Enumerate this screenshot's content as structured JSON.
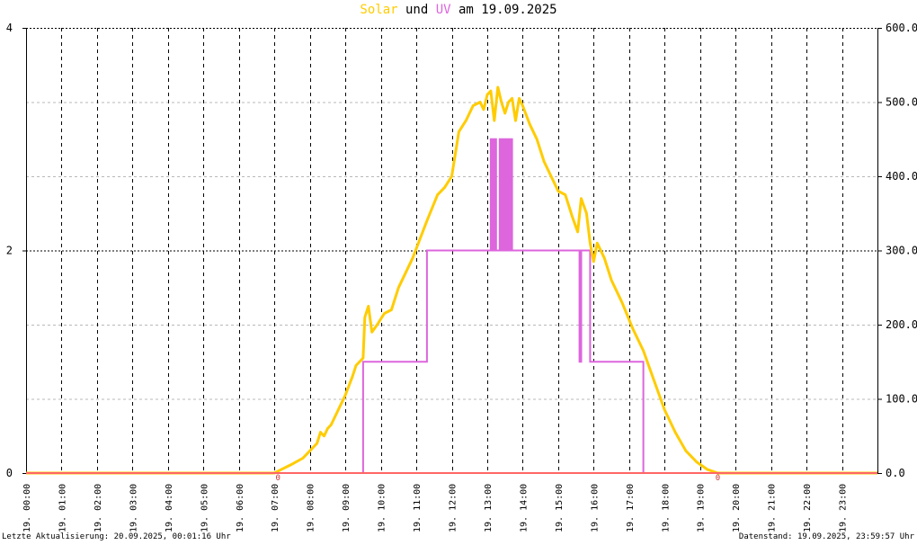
{
  "title": {
    "part1": "Solar",
    "part2": " und ",
    "part3": "UV",
    "part4": " am 19.09.2025"
  },
  "footer": {
    "left": "Letzte Aktualisierung: 20.09.2025, 00:01:16 Uhr",
    "right": "Datenstand: 19.09.2025, 23:59:57 Uhr"
  },
  "colors": {
    "solar": "#ffcc00",
    "uv": "#dd66dd",
    "baseline": "#ff6666",
    "grid": "#000000",
    "grid_minor": "#b8b8b8"
  },
  "chart_data": {
    "type": "line",
    "x_unit": "hours",
    "xlim": [
      0,
      24
    ],
    "x_tick_labels": [
      "19. 00:00",
      "19. 01:00",
      "19. 02:00",
      "19. 03:00",
      "19. 04:00",
      "19. 05:00",
      "19. 06:00",
      "19. 07:00",
      "19. 08:00",
      "19. 09:00",
      "19. 10:00",
      "19. 11:00",
      "19. 12:00",
      "19. 13:00",
      "19. 14:00",
      "19. 15:00",
      "19. 16:00",
      "19. 17:00",
      "19. 18:00",
      "19. 19:00",
      "19. 20:00",
      "19. 21:00",
      "19. 22:00",
      "19. 23:00"
    ],
    "y_left_lim": [
      0,
      4
    ],
    "y_left_ticks": [
      "0",
      "2",
      "4"
    ],
    "y_left_values": [
      0,
      2,
      4
    ],
    "y_right_lim": [
      0,
      600
    ],
    "y_right_ticks": [
      "0.0",
      "100.0",
      "200.0",
      "300.0",
      "400.0",
      "500.0",
      "600.0"
    ],
    "y_right_values": [
      0,
      100,
      200,
      300,
      400,
      500,
      600
    ],
    "grid": true,
    "zero_markers": [
      {
        "x": 7.1,
        "label": "0"
      },
      {
        "x": 19.5,
        "label": "0"
      }
    ],
    "series": [
      {
        "name": "Solar",
        "axis": "right",
        "x": [
          0,
          7.0,
          7.2,
          7.5,
          7.8,
          8.0,
          8.2,
          8.3,
          8.4,
          8.5,
          8.6,
          8.8,
          9.0,
          9.2,
          9.3,
          9.5,
          9.55,
          9.65,
          9.75,
          9.9,
          10.1,
          10.3,
          10.5,
          10.7,
          10.9,
          11.1,
          11.3,
          11.6,
          11.8,
          12.0,
          12.2,
          12.4,
          12.6,
          12.8,
          12.9,
          13.0,
          13.1,
          13.2,
          13.3,
          13.4,
          13.5,
          13.6,
          13.7,
          13.8,
          13.9,
          14.0,
          14.2,
          14.4,
          14.6,
          14.8,
          15.0,
          15.2,
          15.4,
          15.55,
          15.65,
          15.8,
          15.9,
          16.0,
          16.1,
          16.3,
          16.5,
          16.8,
          17.1,
          17.4,
          17.7,
          18.0,
          18.3,
          18.6,
          18.9,
          19.2,
          19.5,
          20.0,
          24
        ],
        "values": [
          0,
          0,
          5,
          12,
          20,
          30,
          40,
          55,
          50,
          60,
          65,
          85,
          105,
          130,
          145,
          155,
          210,
          225,
          190,
          200,
          215,
          220,
          250,
          270,
          290,
          315,
          340,
          375,
          385,
          400,
          460,
          475,
          495,
          500,
          490,
          510,
          515,
          475,
          520,
          500,
          485,
          500,
          505,
          475,
          505,
          495,
          470,
          450,
          420,
          400,
          380,
          375,
          345,
          325,
          370,
          350,
          310,
          285,
          310,
          290,
          260,
          230,
          195,
          165,
          125,
          85,
          55,
          30,
          15,
          5,
          0,
          0,
          0
        ]
      },
      {
        "name": "UV",
        "axis": "left",
        "x": [
          0,
          9.5,
          9.5,
          11.3,
          11.3,
          13.1,
          13.1,
          13.15,
          13.15,
          13.2,
          13.2,
          13.25,
          13.25,
          13.35,
          13.35,
          13.4,
          13.4,
          13.45,
          13.45,
          13.5,
          13.5,
          13.55,
          13.55,
          13.6,
          13.6,
          13.65,
          13.65,
          13.7,
          13.7,
          15.6,
          15.6,
          15.65,
          15.65,
          15.7,
          15.7,
          15.9,
          15.9,
          17.4,
          17.4,
          24
        ],
        "values": [
          0,
          0,
          1,
          1,
          2,
          2,
          3,
          3,
          2,
          2,
          3,
          3,
          2,
          2,
          3,
          3,
          2,
          2,
          3,
          3,
          2,
          2,
          3,
          3,
          2,
          2,
          3,
          3,
          2,
          2,
          1,
          1,
          2,
          2,
          2,
          2,
          1,
          1,
          0,
          0
        ]
      }
    ]
  }
}
